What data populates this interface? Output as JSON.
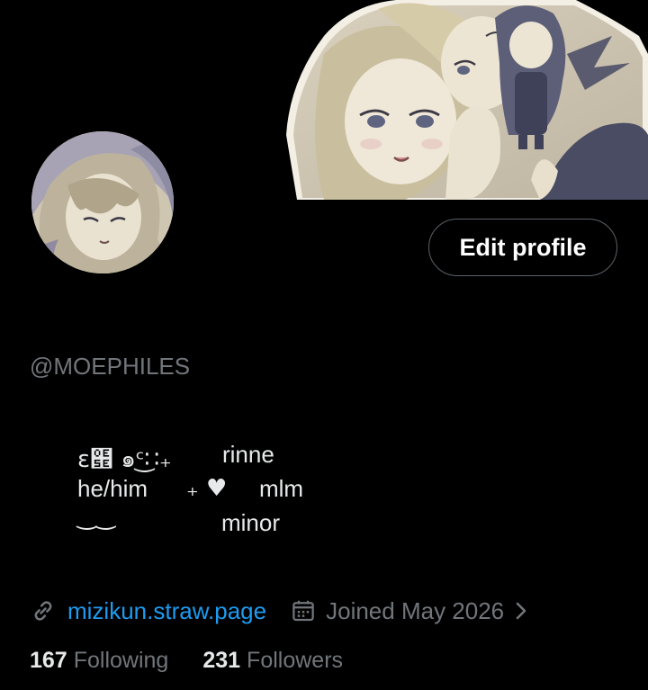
{
  "profile": {
    "handle": "@MOEPHILES",
    "edit_button": "Edit profile",
    "bio": {
      "line1_deco": "ɛ๞ ๑ᶜ͜∷₊",
      "line1_text": "rinne",
      "line2_left": "he/him",
      "line2_mid": "₊ ♥",
      "line2_right": "mlm",
      "line3_deco": "‿‿",
      "line3_text": "minor"
    },
    "website": "mizikun.straw.page",
    "joined": "Joined May 2026",
    "following_count": "167",
    "following_label": "Following",
    "followers_count": "231",
    "followers_label": "Followers"
  },
  "icons": {
    "link": "link-icon",
    "calendar": "calendar-icon",
    "chevron": "chevron-right-icon"
  },
  "colors": {
    "background": "#000000",
    "link": "#1d9bf0",
    "secondary_text": "#71767b",
    "primary_text": "#e7e9ea",
    "button_border": "#5b6168"
  }
}
